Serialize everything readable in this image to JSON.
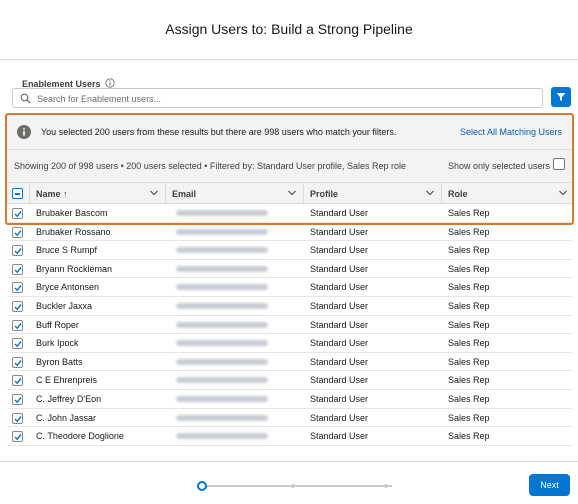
{
  "dialog": {
    "title": "Assign Users to: Build a Strong Pipeline"
  },
  "section": {
    "label": "Enablement Users"
  },
  "search": {
    "placeholder": "Search for Enablement users..."
  },
  "banner": {
    "message": "You selected 200 users from these results but there are 998 users who match your filters.",
    "link": "Select All Matching Users"
  },
  "summary": {
    "text": "Showing 200 of 998 users • 200 users selected • Filtered by: Standard User profile, Sales Rep role",
    "toggle_label": "Show only selected users"
  },
  "table": {
    "headers": {
      "name": "Name ↑",
      "email": "Email",
      "profile": "Profile",
      "role": "Role"
    },
    "rows": [
      {
        "name": "Brubaker Bascom",
        "profile": "Standard User",
        "role": "Sales Rep"
      },
      {
        "name": "Brubaker Rossano",
        "profile": "Standard User",
        "role": "Sales Rep"
      },
      {
        "name": "Bruce S Rumpf",
        "profile": "Standard User",
        "role": "Sales Rep"
      },
      {
        "name": "Bryann Rockleman",
        "profile": "Standard User",
        "role": "Sales Rep"
      },
      {
        "name": "Bryce Antonsen",
        "profile": "Standard User",
        "role": "Sales Rep"
      },
      {
        "name": "Buckler Jaxxa",
        "profile": "Standard User",
        "role": "Sales Rep"
      },
      {
        "name": "Buff Roper",
        "profile": "Standard User",
        "role": "Sales Rep"
      },
      {
        "name": "Burk Ipock",
        "profile": "Standard User",
        "role": "Sales Rep"
      },
      {
        "name": "Byron Batts",
        "profile": "Standard User",
        "role": "Sales Rep"
      },
      {
        "name": "C E Ehrenpreis",
        "profile": "Standard User",
        "role": "Sales Rep"
      },
      {
        "name": "C. Jeffrey D'Eon",
        "profile": "Standard User",
        "role": "Sales Rep"
      },
      {
        "name": "C. John Jassar",
        "profile": "Standard User",
        "role": "Sales Rep"
      },
      {
        "name": "C. Theodore Doglione",
        "profile": "Standard User",
        "role": "Sales Rep"
      }
    ]
  },
  "footer": {
    "next_label": "Next"
  },
  "colors": {
    "brand": "#0176d3",
    "highlight": "#d9792b",
    "link": "#0b5cab"
  }
}
